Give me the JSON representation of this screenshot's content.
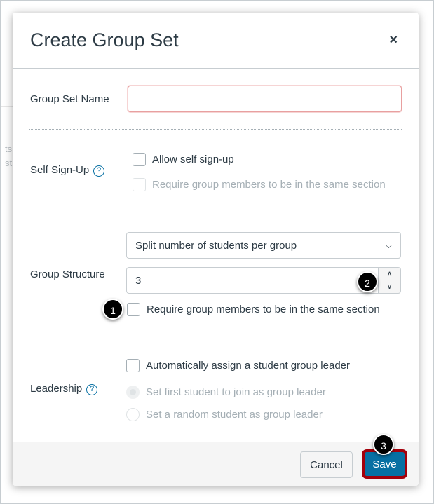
{
  "background": {
    "fragments": [
      "ts",
      "st"
    ]
  },
  "dialog": {
    "title": "Create Group Set",
    "close_label": "×",
    "group_set_name": {
      "label": "Group Set Name",
      "value": ""
    },
    "self_signup": {
      "label": "Self Sign-Up",
      "help": "?",
      "allow": "Allow self sign-up",
      "same_section": "Require group members to be in the same section"
    },
    "group_structure": {
      "label": "Group Structure",
      "select_value": "Split number of students per group",
      "number_value": "3",
      "same_section": "Require group members to be in the same section"
    },
    "leadership": {
      "label": "Leadership",
      "help": "?",
      "auto_assign": "Automatically assign a student group leader",
      "first": "Set first student to join as group leader",
      "random": "Set a random student as group leader"
    },
    "cancel_label": "Cancel",
    "save_label": "Save"
  },
  "callouts": [
    "1",
    "2",
    "3"
  ],
  "colors": {
    "save": "#0770a3",
    "highlight": "#a3000b",
    "badge": "#000000"
  }
}
